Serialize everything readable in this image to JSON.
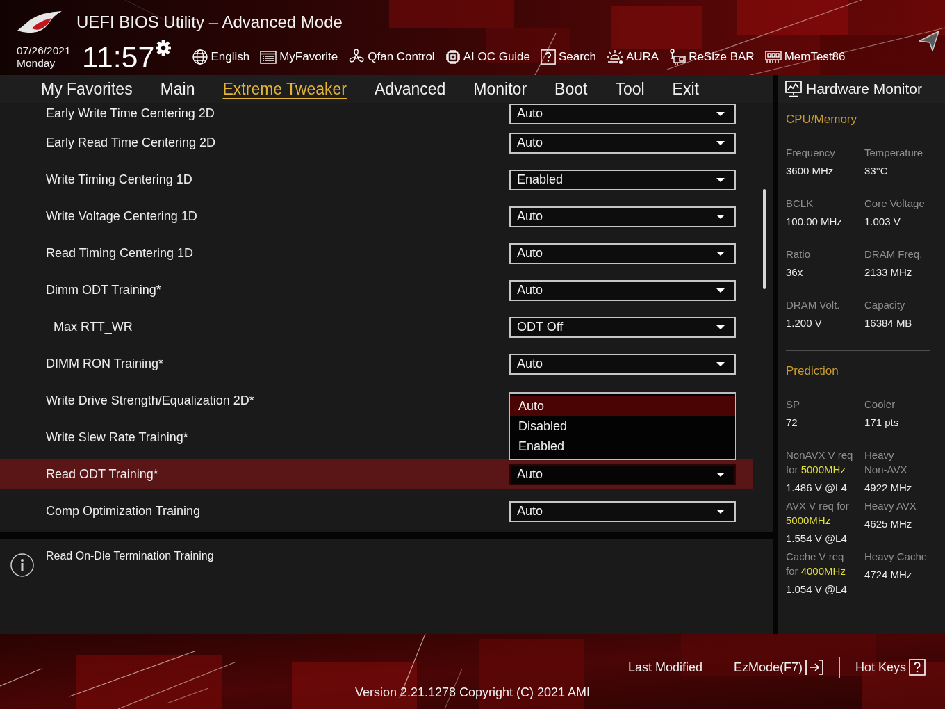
{
  "header": {
    "title": "UEFI BIOS Utility – Advanced Mode",
    "date": "07/26/2021",
    "weekday": "Monday",
    "time": "11:57",
    "toolbar": [
      {
        "kind": "language",
        "label": "English"
      },
      {
        "kind": "favorites",
        "label": "MyFavorite"
      },
      {
        "kind": "fan",
        "label": "Qfan Control"
      },
      {
        "kind": "guide",
        "label": "AI OC Guide"
      },
      {
        "kind": "search",
        "label": "Search"
      },
      {
        "kind": "lighting",
        "label": "AURA"
      },
      {
        "kind": "resize",
        "label": "ReSize BAR"
      },
      {
        "kind": "memtest",
        "label": "MemTest86"
      }
    ]
  },
  "tabs": [
    {
      "label": "My Favorites",
      "selected": false
    },
    {
      "label": "Main",
      "selected": false
    },
    {
      "label": "Extreme Tweaker",
      "selected": true
    },
    {
      "label": "Advanced",
      "selected": false
    },
    {
      "label": "Monitor",
      "selected": false
    },
    {
      "label": "Boot",
      "selected": false
    },
    {
      "label": "Tool",
      "selected": false
    },
    {
      "label": "Exit",
      "selected": false
    }
  ],
  "settings": {
    "rows": [
      {
        "label": "Early Write Time Centering 2D",
        "value": "Auto",
        "selected": false
      },
      {
        "label": "Early Read Time Centering 2D",
        "value": "Auto",
        "selected": false
      },
      {
        "label": "Write Timing Centering 1D",
        "value": "Enabled",
        "selected": false
      },
      {
        "label": "Write Voltage Centering 1D",
        "value": "Auto",
        "selected": false
      },
      {
        "label": "Read Timing Centering 1D",
        "value": "Auto",
        "selected": false
      },
      {
        "label": "Dimm ODT Training*",
        "value": "Auto",
        "selected": false,
        "children": [
          {
            "label": "Max RTT_WR",
            "value": "ODT Off",
            "selected": false
          }
        ]
      },
      {
        "label": "DIMM RON Training*",
        "value": "Auto",
        "selected": false
      },
      {
        "label": "Write Drive Strength/Equalization 2D*",
        "selected": false,
        "options": [
          {
            "label": "Auto",
            "selected": true
          },
          {
            "label": "Disabled",
            "selected": false
          },
          {
            "label": "Enabled",
            "selected": false
          }
        ]
      },
      {
        "label": "Write Slew Rate Training*",
        "selected": false
      },
      {
        "label": "Read ODT Training*",
        "value": "Auto",
        "selected": true
      },
      {
        "label": "Comp Optimization Training",
        "value": "Auto",
        "selected": false
      }
    ]
  },
  "help": {
    "text": "Read On-Die Termination Training"
  },
  "hardware_monitor": {
    "title": "Hardware Monitor",
    "sections": [
      {
        "title": "CPU/Memory",
        "rows": [
          [
            {
              "label": "Frequency",
              "value": "3600 MHz"
            },
            {
              "label": "Temperature",
              "value": "33°C"
            }
          ],
          [
            {
              "label": "BCLK",
              "value": "100.00 MHz"
            },
            {
              "label": "Core Voltage",
              "value": "1.003 V"
            }
          ],
          [
            {
              "label": "Ratio",
              "value": "36x"
            },
            {
              "label": "DRAM Freq.",
              "value": "2133 MHz"
            }
          ],
          [
            {
              "label": "DRAM Volt.",
              "value": "1.200 V"
            },
            {
              "label": "Capacity",
              "value": "16384 MB"
            }
          ]
        ]
      },
      {
        "title": "Prediction",
        "rows": [
          [
            {
              "label": "SP",
              "value": "72"
            },
            {
              "label": "Cooler",
              "value": "171 pts"
            }
          ],
          [
            {
              "label": "NonAVX V req for **5000MHz**",
              "value": "1.486 V @L4"
            },
            {
              "label": "Heavy Non-AVX",
              "value": "4922 MHz"
            }
          ],
          [
            {
              "label": "AVX V req for **5000MHz**",
              "value": "1.554 V @L4"
            },
            {
              "label": "Heavy AVX",
              "value": "4625 MHz"
            }
          ],
          [
            {
              "label": "Cache V req for **4000MHz**",
              "value": "1.054 V @L4"
            },
            {
              "label": "Heavy Cache",
              "value": "4724 MHz"
            }
          ]
        ]
      }
    ]
  },
  "footer": {
    "buttons": [
      {
        "kind": "history",
        "label": "Last Modified"
      },
      {
        "kind": "ezmode",
        "label": "EzMode(F7)"
      },
      {
        "kind": "hotkeys",
        "label": "Hot Keys"
      }
    ],
    "version": "Version 2.21.1278 Copyright (C) 2021 AMI"
  }
}
